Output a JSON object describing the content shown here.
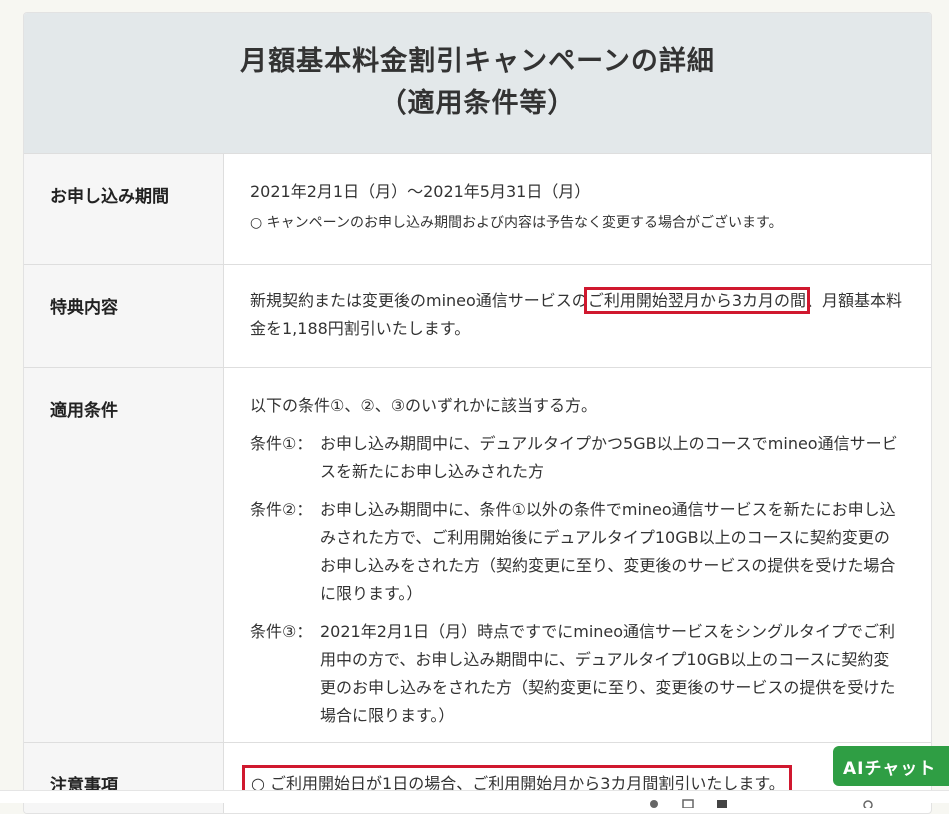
{
  "header": {
    "title_line1": "月額基本料金割引キャンペーンの詳細",
    "title_line2": "（適用条件等）"
  },
  "rows": {
    "period": {
      "label": "お申し込み期間",
      "date_text": "2021年2月1日（月）～2021年5月31日（月）",
      "note": "○ キャンペーンのお申し込み期間および内容は予告なく変更する場合がございます。"
    },
    "benefit": {
      "label": "特典内容",
      "text_before": "新規契約または変更後のmineo通信サービスの",
      "text_highlight": "ご利用開始翌月から3カ月の間",
      "text_after": "、月額基本料金を1,188円割引いたします。"
    },
    "conditions": {
      "label": "適用条件",
      "intro": "以下の条件①、②、③のいずれかに該当する方。",
      "items": [
        {
          "label": "条件①：",
          "text": "お申し込み期間中に、デュアルタイプかつ5GB以上のコースでmineo通信サービスを新たにお申し込みされた方"
        },
        {
          "label": "条件②：",
          "text": "お申し込み期間中に、条件①以外の条件でmineo通信サービスを新たにお申し込みされた方で、ご利用開始後にデュアルタイプ10GB以上のコースに契約変更のお申し込みをされた方（契約変更に至り、変更後のサービスの提供を受けた場合に限ります。）"
        },
        {
          "label": "条件③：",
          "text": "2021年2月1日（月）時点ですでにmineo通信サービスをシングルタイプでご利用中の方で、お申し込み期間中に、デュアルタイプ10GB以上のコースに契約変更のお申し込みをされた方（契約変更に至り、変更後のサービスの提供を受けた場合に限ります。）"
        }
      ]
    },
    "notes": {
      "label": "注意事項",
      "text": "○ ご利用開始日が1日の場合、ご利用開始月から3カ月間割引いたします。"
    }
  },
  "chat_button": {
    "label": "AIチャット"
  },
  "colors": {
    "highlight": "#d0182f",
    "header_bg": "#e3e8ea",
    "chat_bg": "#2f9e44"
  }
}
